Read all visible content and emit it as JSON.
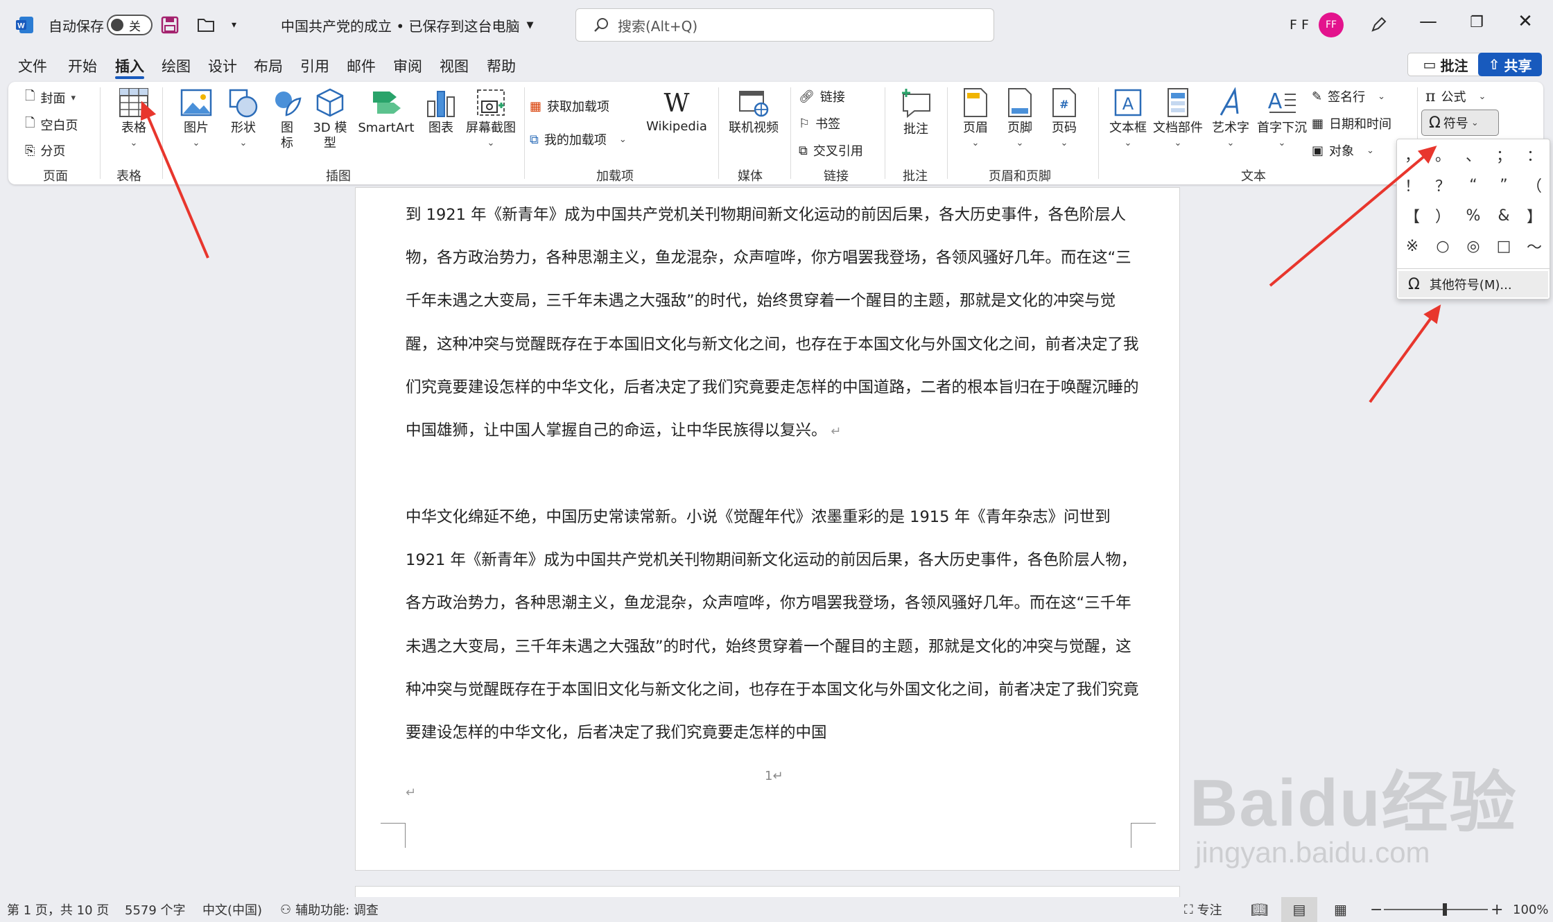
{
  "titlebar": {
    "autosave_label": "自动保存",
    "toggle_state": "关",
    "doc_title": "中国共产党的成立 • 已保存到这台电脑",
    "search_placeholder": "搜索(Alt+Q)",
    "user_initials": "F F",
    "avatar_initials": "FF"
  },
  "menu": {
    "tabs": [
      "文件",
      "开始",
      "插入",
      "绘图",
      "设计",
      "布局",
      "引用",
      "邮件",
      "审阅",
      "视图",
      "帮助"
    ],
    "active": "插入",
    "comment_btn": "批注",
    "share_btn": "共享"
  },
  "ribbon": {
    "pages": {
      "cover": "封面",
      "blank": "空白页",
      "break": "分页",
      "group": "页面"
    },
    "tables": {
      "table": "表格",
      "group": "表格"
    },
    "illustrations": {
      "picture": "图片",
      "shapes": "形状",
      "icons": "图标",
      "model3d": "3D 模型",
      "smartart": "SmartArt",
      "chart": "图表",
      "screenshot": "屏幕截图",
      "group": "插图"
    },
    "addins": {
      "get": "获取加载项",
      "my": "我的加载项",
      "wikipedia": "Wikipedia",
      "group": "加载项"
    },
    "media": {
      "video": "联机视频",
      "group": "媒体"
    },
    "links": {
      "link": "链接",
      "bookmark": "书签",
      "crossref": "交叉引用",
      "group": "链接"
    },
    "comments": {
      "comment": "批注",
      "group": "批注"
    },
    "headerfooter": {
      "header": "页眉",
      "footer": "页脚",
      "pagenum": "页码",
      "group": "页眉和页脚"
    },
    "text": {
      "textbox": "文本框",
      "quickparts": "文档部件",
      "wordart": "艺术字",
      "dropcap": "首字下沉",
      "signature": "签名行",
      "datetime": "日期和时间",
      "object": "对象",
      "group": "文本"
    },
    "symbols": {
      "equation": "公式",
      "symbol": "符号"
    }
  },
  "symbols": {
    "cells": [
      "，",
      "。",
      "、",
      "；",
      "：",
      "！",
      "？",
      "“",
      "”",
      "（",
      "【",
      "）",
      "%",
      "&",
      "】",
      "※",
      "○",
      "◎",
      "□",
      "～"
    ],
    "more": "其他符号(M)..."
  },
  "document": {
    "paragraphs": [
      "到 1921 年《新青年》成为中国共产党机关刊物期间新文化运动的前因后果，各大历史事件，各色阶层人物，各方政治势力，各种思潮主义，鱼龙混杂，众声喧哗，你方唱罢我登场，各领风骚好几年。而在这“三千年未遇之大变局，三千年未遇之大强敌”的时代，始终贯穿着一个醒目的主题，那就是文化的冲突与觉醒，这种冲突与觉醒既存在于本国旧文化与新文化之间，也存在于本国文化与外国文化之间，前者决定了我们究竟要建设怎样的中华文化，后者决定了我们究竟要走怎样的中国道路，二者的根本旨归在于唤醒沉睡的中国雄狮，让中国人掌握自己的命运，让中华民族得以复兴。",
      "中华文化绵延不绝，中国历史常读常新。小说《觉醒年代》浓墨重彩的是 1915 年《青年杂志》问世到 1921 年《新青年》成为中国共产党机关刊物期间新文化运动的前因后果，各大历史事件，各色阶层人物，各方政治势力，各种思潮主义，鱼龙混杂，众声喧哗，你方唱罢我登场，各领风骚好几年。而在这“三千年未遇之大变局，三千年未遇之大强敌”的时代，始终贯穿着一个醒目的主题，那就是文化的冲突与觉醒，这种冲突与觉醒既存在于本国旧文化与新文化之间，也存在于本国文化与外国文化之间，前者决定了我们究竟要建设怎样的中华文化，后者决定了我们究竟要走怎样的中国"
    ],
    "page_number": "1"
  },
  "statusbar": {
    "page": "第 1 页，共 10 页",
    "words": "5579 个字",
    "lang": "中文(中国)",
    "accessibility": "辅助功能: 调查",
    "focus": "专注",
    "zoom": "100%",
    "zoom_level": 100
  },
  "watermark": {
    "brand": "Baidu经验",
    "url": "jingyan.baidu.com"
  },
  "colors": {
    "accent": "#185abd",
    "avatar": "#e3138d",
    "arrow": "#e8362d"
  }
}
